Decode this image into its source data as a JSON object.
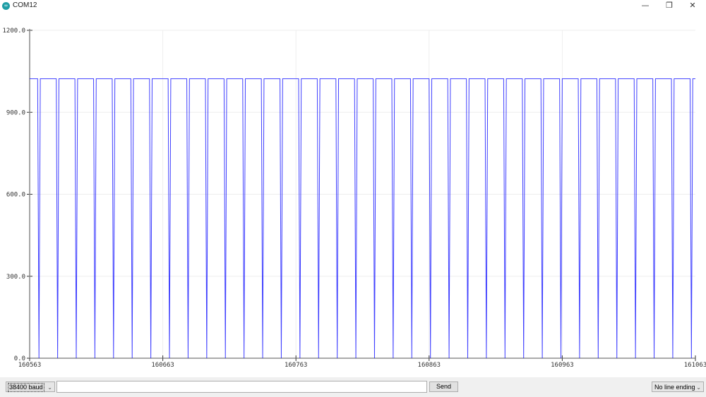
{
  "window": {
    "title": "COM12",
    "icon": "arduino-icon",
    "minimize": "—",
    "restore": "❐",
    "close": "✕"
  },
  "controls": {
    "baud": "38400 baud",
    "message_value": "",
    "send_label": "Send",
    "line_ending": "No line ending"
  },
  "chart_data": {
    "type": "line",
    "title": "",
    "xlabel": "",
    "ylabel": "",
    "xlim": [
      160563,
      161063
    ],
    "ylim": [
      0,
      1200
    ],
    "x_ticks": [
      160563,
      160663,
      160763,
      160863,
      160963,
      161063
    ],
    "y_ticks": [
      "0.0",
      "300.0",
      "600.0",
      "900.0",
      "1200.0"
    ],
    "grid": true,
    "legend": "none",
    "line_color": "#0000ff",
    "series": [
      {
        "x_start": 160563,
        "values": [
          1023,
          1023,
          1023,
          1023,
          1023,
          1023,
          1023,
          0,
          1023,
          1023,
          1023,
          1023,
          1023,
          1023,
          1023,
          1023,
          1023,
          1023,
          1023,
          1023,
          1023,
          0,
          1023,
          1023,
          1023,
          1023,
          1023,
          1023,
          1023,
          1023,
          1023,
          1023,
          1023,
          1023,
          1023,
          0,
          1023,
          1023,
          1023,
          1023,
          1023,
          1023,
          1023,
          1023,
          1023,
          1023,
          1023,
          1023,
          1023,
          0,
          1023,
          1023,
          1023,
          1023,
          1023,
          1023,
          1023,
          1023,
          1023,
          1023,
          1023,
          1023,
          1023,
          0,
          1023,
          1023,
          1023,
          1023,
          1023,
          1023,
          1023,
          1023,
          1023,
          1023,
          1023,
          1023,
          1023,
          0,
          1023,
          1023,
          1023,
          1023,
          1023,
          1023,
          1023,
          1023,
          1023,
          1023,
          1023,
          1023,
          1023,
          0,
          1023,
          1023,
          1023,
          1023,
          1023,
          1023,
          1023,
          1023,
          1023,
          1023,
          1023,
          1023,
          1023,
          0,
          1023,
          1023,
          1023,
          1023,
          1023,
          1023,
          1023,
          1023,
          1023,
          1023,
          1023,
          1023,
          1023,
          0,
          1023,
          1023,
          1023,
          1023,
          1023,
          1023,
          1023,
          1023,
          1023,
          1023,
          1023,
          1023,
          1023,
          0,
          1023,
          1023,
          1023,
          1023,
          1023,
          1023,
          1023,
          1023,
          1023,
          1023,
          1023,
          1023,
          1023,
          0,
          1023,
          1023,
          1023,
          1023,
          1023,
          1023,
          1023,
          1023,
          1023,
          1023,
          1023,
          1023,
          1023,
          0,
          1023,
          1023,
          1023,
          1023,
          1023,
          1023,
          1023,
          1023,
          1023,
          1023,
          1023,
          1023,
          1023,
          0,
          1023,
          1023,
          1023,
          1023,
          1023,
          1023,
          1023,
          1023,
          1023,
          1023,
          1023,
          1023,
          1023,
          0,
          1023,
          1023,
          1023,
          1023,
          1023,
          1023,
          1023,
          1023,
          1023,
          1023,
          1023,
          1023,
          1023,
          0,
          1023,
          1023,
          1023,
          1023,
          1023,
          1023,
          1023,
          1023,
          1023,
          1023,
          1023,
          1023,
          1023,
          0,
          1023,
          1023,
          1023,
          1023,
          1023,
          1023,
          1023,
          1023,
          1023,
          1023,
          1023,
          1023,
          1023,
          0,
          1023,
          1023,
          1023,
          1023,
          1023,
          1023,
          1023,
          1023,
          1023,
          1023,
          1023,
          1023,
          1023,
          0,
          1023,
          1023,
          1023,
          1023,
          1023,
          1023,
          1023,
          1023,
          1023,
          1023,
          1023,
          1023,
          1023,
          0,
          1023,
          1023,
          1023,
          1023,
          1023,
          1023,
          1023,
          1023,
          1023,
          1023,
          1023,
          1023,
          1023,
          0,
          1023,
          1023,
          1023,
          1023,
          1023,
          1023,
          1023,
          1023,
          1023,
          1023,
          1023,
          1023,
          1023,
          0,
          1023,
          1023,
          1023,
          1023,
          1023,
          1023,
          1023,
          1023,
          1023,
          1023,
          1023,
          1023,
          1023,
          0,
          1023,
          1023,
          1023,
          1023,
          1023,
          1023,
          1023,
          1023,
          1023,
          1023,
          1023,
          1023,
          1023,
          0,
          1023,
          1023,
          1023,
          1023,
          1023,
          1023,
          1023,
          1023,
          1023,
          1023,
          1023,
          1023,
          1023,
          0,
          1023,
          1023,
          1023,
          1023,
          1023,
          1023,
          1023,
          1023,
          1023,
          1023,
          1023,
          1023,
          1023,
          0,
          1023,
          1023,
          1023,
          1023,
          1023,
          1023,
          1023,
          1023,
          1023,
          1023,
          1023,
          1023,
          1023,
          0,
          1023,
          1023,
          1023,
          1023,
          1023,
          1023,
          1023,
          1023,
          1023,
          1023,
          1023,
          1023,
          1023,
          0,
          1023,
          1023,
          1023,
          1023,
          1023,
          1023,
          1023,
          1023,
          1023,
          1023,
          1023,
          1023,
          1023,
          0,
          1023,
          1023,
          1023,
          1023,
          1023,
          1023,
          1023,
          1023,
          1023,
          1023,
          1023,
          1023,
          1023,
          0,
          1023,
          1023,
          1023,
          1023,
          1023,
          1023,
          1023,
          1023,
          1023,
          1023,
          1023,
          1023,
          1023,
          0,
          1023,
          1023,
          1023,
          1023,
          1023,
          1023,
          1023,
          1023,
          1023,
          1023,
          1023,
          1023,
          1023,
          0,
          1023,
          1023,
          1023,
          1023,
          1023,
          1023,
          1023,
          1023,
          1023,
          1023,
          1023,
          1023,
          1023,
          0,
          1023,
          1023,
          1023,
          1023,
          1023,
          1023,
          1023,
          1023,
          1023,
          1023,
          1023,
          1023,
          1023,
          0,
          1023,
          1023,
          1023,
          1023,
          1023,
          1023,
          1023,
          1023,
          1023,
          1023,
          1023,
          1023,
          1023,
          0,
          1023,
          1023,
          1023,
          1023,
          1023,
          1023,
          1023,
          1023,
          1023,
          1023,
          1023,
          1023,
          1023,
          0,
          1023,
          1023,
          1023,
          1023,
          1023,
          1023,
          1023,
          1023,
          1023,
          1023,
          1023,
          1023,
          1023,
          0,
          1023,
          1023,
          1023
        ]
      }
    ]
  }
}
